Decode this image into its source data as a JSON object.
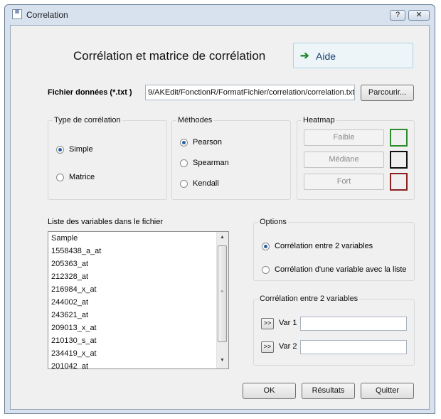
{
  "window": {
    "title": "Correlation",
    "help_button": "?",
    "close_button": "✕"
  },
  "header": {
    "title": "Corrélation et matrice de corrélation",
    "help_label": "Aide"
  },
  "file": {
    "label": "Fichier données (*.txt )",
    "value": "9/AKEdit/FonctionR/FormatFichier/correlation/correlation.txt",
    "browse_label": "Parcourir..."
  },
  "correlation_type": {
    "title": "Type de corrélation",
    "options": [
      "Simple",
      "Matrice"
    ],
    "selected": "Simple"
  },
  "methods": {
    "title": "Méthodes",
    "options": [
      "Pearson",
      "Spearman",
      "Kendall"
    ],
    "selected": "Pearson"
  },
  "heatmap": {
    "title": "Heatmap",
    "items": [
      {
        "label": "Faible",
        "color": "#2e8b2e"
      },
      {
        "label": "Médiane",
        "color": "#111111"
      },
      {
        "label": "Fort",
        "color": "#8b2020"
      }
    ]
  },
  "variables": {
    "title": "Liste des variables dans le fichier",
    "items": [
      "Sample",
      "1558438_a_at",
      "205363_at",
      "212328_at",
      "216984_x_at",
      "244002_at",
      "243621_at",
      "209013_x_at",
      "210130_s_at",
      "234419_x_at",
      "201042_at"
    ]
  },
  "options": {
    "title": "Options",
    "items": [
      "Corrélation entre 2 variables",
      "Corrélation d'une variable avec la liste"
    ],
    "selected": "Corrélation entre 2 variables"
  },
  "two_vars": {
    "title": "Corrélation entre 2 variables",
    "move_label": ">>",
    "var1_label": "Var 1",
    "var2_label": "Var 2",
    "var1_value": "",
    "var2_value": ""
  },
  "footer": {
    "ok": "OK",
    "results": "Résultats",
    "quit": "Quitter"
  }
}
